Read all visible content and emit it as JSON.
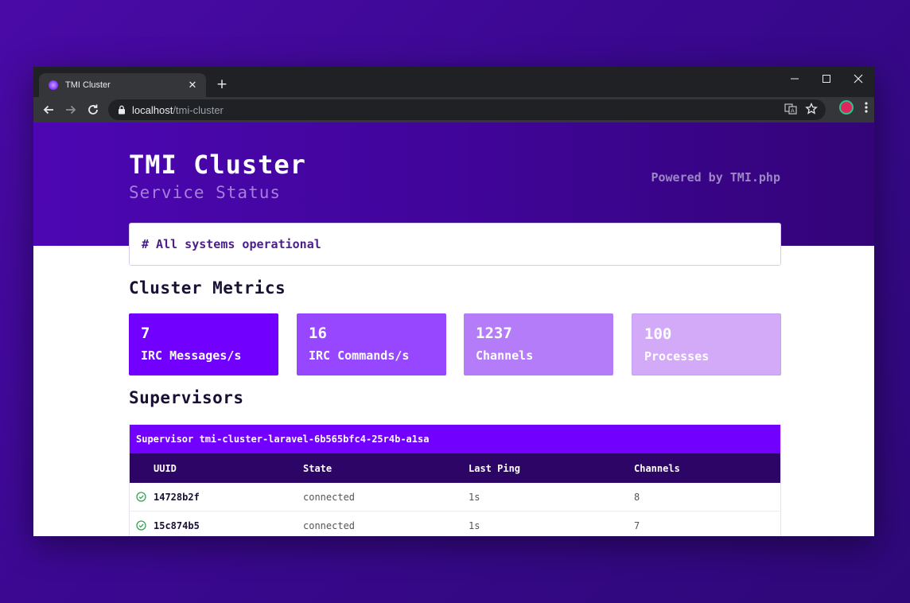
{
  "browser": {
    "tab_title": "TMI Cluster",
    "url_host": "localhost",
    "url_path": "/tmi-cluster"
  },
  "header": {
    "title": "TMI Cluster",
    "subtitle": "Service Status",
    "powered_by": "Powered by TMI.php"
  },
  "status": {
    "message": "# All systems operational"
  },
  "metrics": {
    "section_title": "Cluster Metrics",
    "items": [
      {
        "value": "7",
        "label": "IRC Messages/s",
        "color": "#7200fe"
      },
      {
        "value": "16",
        "label": "IRC Commands/s",
        "color": "#9647ff"
      },
      {
        "value": "1237",
        "label": "Channels",
        "color": "#b57cfa"
      },
      {
        "value": "100",
        "label": "Processes",
        "color": "#d3aaf8"
      }
    ]
  },
  "supervisors": {
    "section_title": "Supervisors",
    "items": [
      {
        "title": "Supervisor tmi-cluster-laravel-6b565bfc4-25r4b-a1sa",
        "columns": [
          "UUID",
          "State",
          "Last Ping",
          "Channels"
        ],
        "rows": [
          {
            "uuid": "14728b2f",
            "state": "connected",
            "last_ping": "1s",
            "channels": "8"
          },
          {
            "uuid": "15c874b5",
            "state": "connected",
            "last_ping": "1s",
            "channels": "7"
          }
        ]
      }
    ]
  },
  "colors": {
    "accent": "#7200fe",
    "header_dark": "#2d0566",
    "ok_green": "#3aa657"
  }
}
